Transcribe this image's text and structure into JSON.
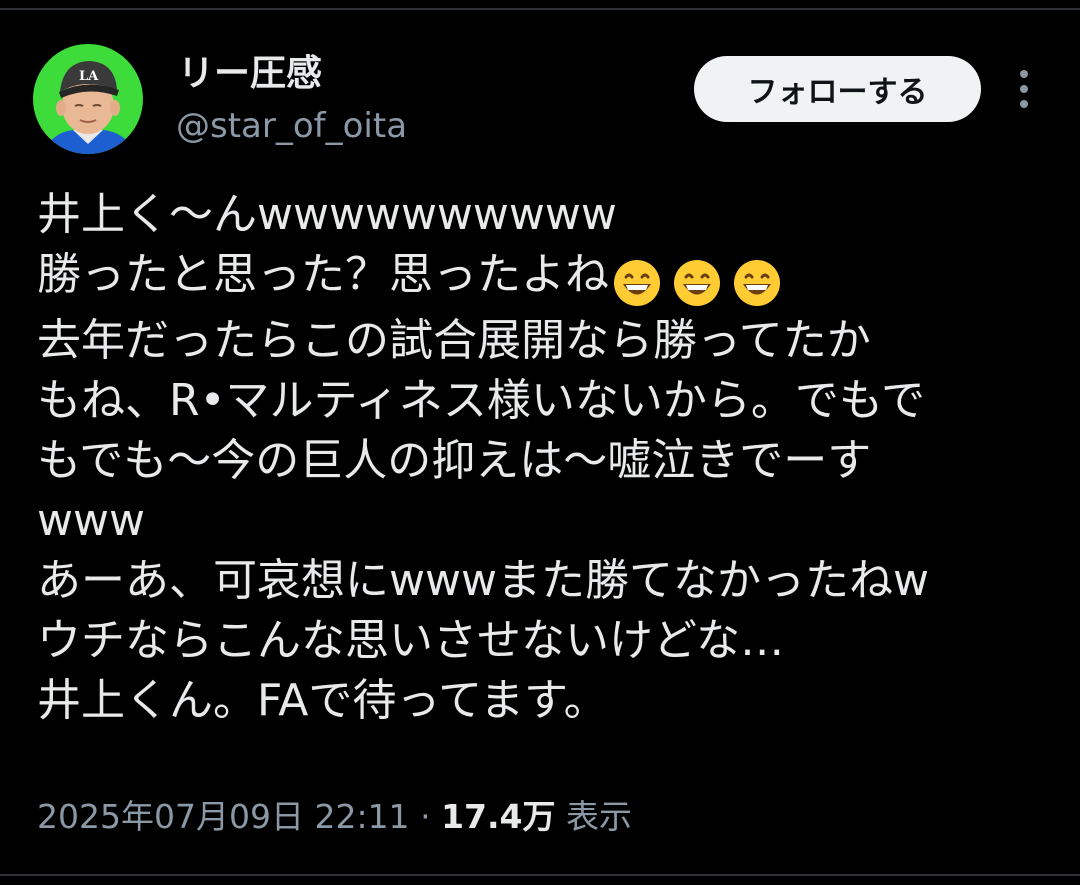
{
  "author": {
    "display_name": "リー圧感",
    "handle": "@star_of_oita",
    "cap_logo": "LA"
  },
  "actions": {
    "follow_label": "フォローする",
    "more_icon": "more-vertical-icon"
  },
  "tweet": {
    "lines": [
      "井上く〜んwwwwwwwwww",
      "勝ったと思った？思ったよね",
      "去年だったらこの試合展開なら勝ってたか",
      "もね、R•マルティネス様いないから。でもで",
      "もでも〜今の巨人の抑えは〜嘘泣きでーす",
      "www",
      "あーあ、可哀想にwwwまた勝てなかったねw",
      "ウチならこんな思いさせないけどな…",
      "井上くん。FAで待ってます。"
    ],
    "emoji_name": "grinning-face-with-smiling-eyes-emoji"
  },
  "meta": {
    "timestamp": "2025年07月09日 22:11",
    "separator": "·",
    "views_count": "17.4万",
    "views_label": "表示"
  },
  "colors": {
    "background": "#000000",
    "text_primary": "#e7e9ea",
    "text_secondary": "#8b98a5",
    "follow_bg": "#eff3f4",
    "avatar_bg": "#3ddc3a"
  }
}
